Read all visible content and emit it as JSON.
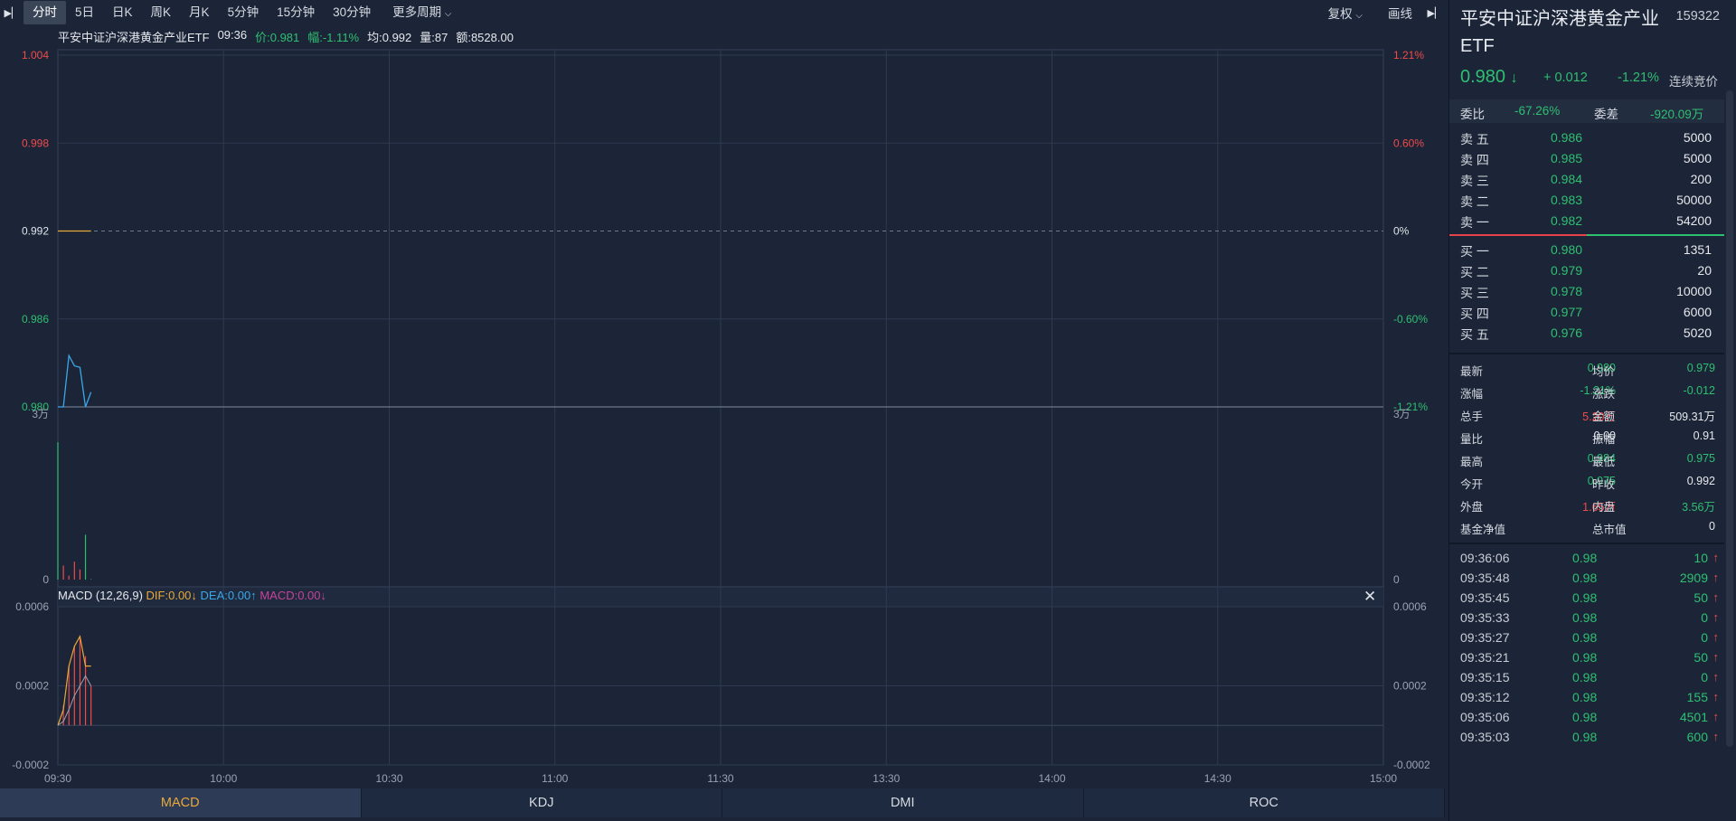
{
  "toolbar": {
    "periods": [
      "分时",
      "5日",
      "日K",
      "周K",
      "月K",
      "5分钟",
      "15分钟",
      "30分钟"
    ],
    "more_periods": "更多周期",
    "fuquan": "复权",
    "huaxian": "画线"
  },
  "info": {
    "name": "平安中证沪深港黄金产业ETF",
    "time": "09:36",
    "price": "价:0.981",
    "change": "幅:-1.11%",
    "avg": "均:0.992",
    "vol": "量:87",
    "amount": "额:8528.00"
  },
  "macd_header": {
    "label": "MACD (12,26,9)",
    "dif": "DIF:0.00↓",
    "dea": "DEA:0.00↑",
    "macd": "MACD:0.00↓"
  },
  "bottom_tabs": [
    "MACD",
    "KDJ",
    "DMI",
    "ROC"
  ],
  "chart_data": [
    {
      "type": "line",
      "y_left_ticks": [
        "1.004",
        "0.998",
        "0.992",
        "0.986",
        "0.980"
      ],
      "y_right_ticks": [
        "1.21%",
        "0.60%",
        "0%",
        "-0.60%",
        "-1.21%"
      ],
      "ylim": [
        0.98,
        1.004
      ],
      "prev_close": 0.992,
      "x": [
        "09:30",
        "09:31",
        "09:32",
        "09:33",
        "09:34",
        "09:35",
        "09:36"
      ],
      "series": [
        {
          "values": [
            0.98,
            0.98,
            0.9835,
            0.9828,
            0.9827,
            0.98,
            0.981
          ],
          "color": "#3aa7e8"
        },
        {
          "values": [
            0.992,
            0.992,
            0.992,
            0.992,
            0.992,
            0.992,
            0.992
          ],
          "color": "#e8a93a"
        }
      ]
    },
    {
      "type": "bar",
      "y_ticks_left": [
        "3万",
        "0"
      ],
      "y_ticks_right": [
        "3万",
        "0"
      ],
      "ylim": [
        0,
        30000
      ],
      "x": [
        "09:30",
        "09:31",
        "09:32",
        "09:33",
        "09:34",
        "09:35",
        "09:36"
      ],
      "values": [
        24500,
        2500,
        700,
        3200,
        1800,
        8000,
        87
      ]
    },
    {
      "type": "line",
      "y_ticks": [
        "0.0006",
        "0.0002",
        "-0.0002"
      ],
      "ylim": [
        -0.0002,
        0.0006
      ],
      "x": [
        "09:30",
        "09:31",
        "09:32",
        "09:33",
        "09:34",
        "09:35",
        "09:36"
      ],
      "macd_bars": [
        0,
        0.0001,
        0.0003,
        0.0004,
        0.00045,
        0.00035,
        0.0002
      ],
      "dif": [
        0,
        8e-05,
        0.0003,
        0.0004,
        0.00045,
        0.0003,
        0.0003
      ],
      "dea": [
        0,
        2e-05,
        8e-05,
        0.00015,
        0.0002,
        0.00025,
        0.0002
      ]
    }
  ],
  "x_axis": [
    "09:30",
    "10:00",
    "10:30",
    "11:00",
    "11:30",
    "13:30",
    "14:00",
    "14:30",
    "15:00"
  ],
  "panel": {
    "title": "平安中证沪深港黄金产业ETF",
    "code": "159322",
    "price": "0.980",
    "change": "+ 0.012",
    "pct": "-1.21%",
    "status": "连续竞价",
    "weibi_label": "委比",
    "weibi": "-67.26%",
    "weicha_label": "委差",
    "weicha": "-920.09万",
    "asks": [
      {
        "label": "卖 五",
        "price": "0.986",
        "vol": "5000"
      },
      {
        "label": "卖 四",
        "price": "0.985",
        "vol": "5000"
      },
      {
        "label": "卖 三",
        "price": "0.984",
        "vol": "200"
      },
      {
        "label": "卖 二",
        "price": "0.983",
        "vol": "50000"
      },
      {
        "label": "卖 一",
        "price": "0.982",
        "vol": "54200"
      }
    ],
    "bids": [
      {
        "label": "买 一",
        "price": "0.980",
        "vol": "1351"
      },
      {
        "label": "买 二",
        "price": "0.979",
        "vol": "20"
      },
      {
        "label": "买 三",
        "price": "0.978",
        "vol": "10000"
      },
      {
        "label": "买 四",
        "price": "0.977",
        "vol": "6000"
      },
      {
        "label": "买 五",
        "price": "0.976",
        "vol": "5020"
      }
    ],
    "stats": [
      {
        "k1": "最新",
        "v1": "0.980",
        "c1": "green",
        "k2": "均价",
        "v2": "0.979",
        "c2": "green"
      },
      {
        "k1": "涨幅",
        "v1": "-1.21%",
        "c1": "green",
        "k2": "涨跌",
        "v2": "-0.012",
        "c2": "green"
      },
      {
        "k1": "总手",
        "v1": "5.20万",
        "c1": "red",
        "k2": "金额",
        "v2": "509.31万",
        "c2": "white"
      },
      {
        "k1": "量比",
        "v1": "0.00",
        "c1": "white",
        "k2": "振幅",
        "v2": "0.91",
        "c2": "white"
      },
      {
        "k1": "最高",
        "v1": "0.984",
        "c1": "green",
        "k2": "最低",
        "v2": "0.975",
        "c2": "green"
      },
      {
        "k1": "今开",
        "v1": "0.975",
        "c1": "green",
        "k2": "昨收",
        "v2": "0.992",
        "c2": "white"
      },
      {
        "k1": "外盘",
        "v1": "1.65万",
        "c1": "red",
        "k2": "内盘",
        "v2": "3.56万",
        "c2": "green"
      },
      {
        "k1": "基金净值",
        "v1": "",
        "c1": "white",
        "k2": "总市值",
        "v2": "0",
        "c2": "white"
      }
    ],
    "ticks": [
      {
        "time": "09:36:06",
        "price": "0.98",
        "vol": "10"
      },
      {
        "time": "09:35:48",
        "price": "0.98",
        "vol": "2909"
      },
      {
        "time": "09:35:45",
        "price": "0.98",
        "vol": "50"
      },
      {
        "time": "09:35:33",
        "price": "0.98",
        "vol": "0"
      },
      {
        "time": "09:35:27",
        "price": "0.98",
        "vol": "0"
      },
      {
        "time": "09:35:21",
        "price": "0.98",
        "vol": "50"
      },
      {
        "time": "09:35:15",
        "price": "0.98",
        "vol": "0"
      },
      {
        "time": "09:35:12",
        "price": "0.98",
        "vol": "155"
      },
      {
        "time": "09:35:06",
        "price": "0.98",
        "vol": "4501"
      },
      {
        "time": "09:35:03",
        "price": "0.98",
        "vol": "600"
      }
    ],
    "tick_arrow": "↑"
  },
  "colors": {
    "up": "#f04a4a",
    "down": "#2fbf71",
    "price_line": "#3aa7e8",
    "avg_line": "#e8a93a",
    "accent": "#e8a93a"
  }
}
